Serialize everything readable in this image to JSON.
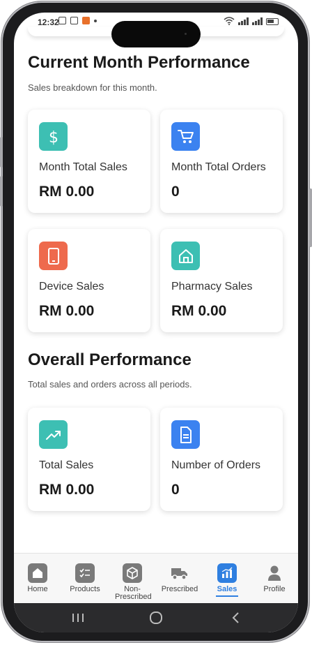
{
  "status_bar": {
    "time": "12:32"
  },
  "current_month": {
    "title": "Current Month Performance",
    "subtitle": "Sales breakdown for this month.",
    "cards": [
      {
        "label": "Month Total Sales",
        "value": "RM 0.00",
        "icon": "dollar-icon",
        "color": "#3dbfb3"
      },
      {
        "label": "Month Total Orders",
        "value": "0",
        "icon": "cart-icon",
        "color": "#3b82f0"
      },
      {
        "label": "Device Sales",
        "value": "RM 0.00",
        "icon": "phone-device-icon",
        "color": "#ee6a4d"
      },
      {
        "label": "Pharmacy Sales",
        "value": "RM 0.00",
        "icon": "home-icon",
        "color": "#3dbfb3"
      }
    ]
  },
  "overall": {
    "title": "Overall Performance",
    "subtitle": "Total sales and orders across all periods.",
    "cards": [
      {
        "label": "Total Sales",
        "value": "RM 0.00",
        "icon": "trending-up-icon",
        "color": "#3dbfb3"
      },
      {
        "label": "Number of Orders",
        "value": "0",
        "icon": "document-icon",
        "color": "#3b82f0"
      }
    ]
  },
  "nav": {
    "items": [
      {
        "label": "Home",
        "icon": "home-icon"
      },
      {
        "label": "Products",
        "icon": "checklist-icon"
      },
      {
        "label": "Non-Prescribed",
        "icon": "box-icon"
      },
      {
        "label": "Prescribed",
        "icon": "truck-icon"
      },
      {
        "label": "Sales",
        "icon": "chart-icon",
        "active": true
      },
      {
        "label": "Profile",
        "icon": "user-icon"
      }
    ],
    "accent": "#2f7fe0"
  }
}
